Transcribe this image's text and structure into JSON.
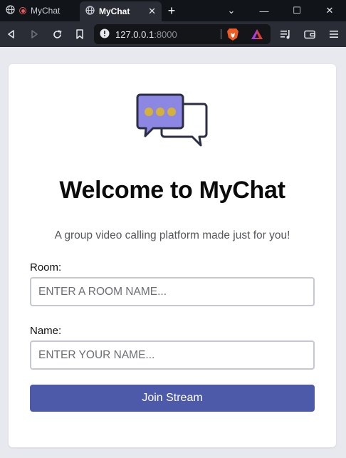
{
  "browser": {
    "tabs": [
      {
        "label": "MyChat",
        "close": ""
      },
      {
        "label": "MyChat",
        "close": "✕"
      }
    ],
    "new_tab": "+",
    "window_controls": {
      "dropdown": "⌄",
      "minimize": "—",
      "maximize": "☐",
      "close": "✕"
    },
    "url": {
      "host": "127.0.0.1",
      "port": ":8000"
    },
    "icons": [
      "back-icon",
      "forward-icon",
      "reload-icon",
      "bookmark-icon",
      "site-info-icon",
      "brave-shields-icon",
      "brave-rewards-icon",
      "playlist-icon",
      "wallet-icon",
      "menu-icon"
    ]
  },
  "page": {
    "title": "Welcome to MyChat",
    "subtitle": "A group video calling platform made just for you!",
    "room": {
      "label": "Room:",
      "placeholder": "ENTER A ROOM NAME..."
    },
    "name": {
      "label": "Name:",
      "placeholder": "ENTER YOUR NAME..."
    },
    "join_label": "Join Stream"
  },
  "colors": {
    "accent": "#4c5aa9",
    "logo_bubble": "#8c87e2",
    "logo_dots": "#d4b13a",
    "background": "#e8e9ef"
  }
}
